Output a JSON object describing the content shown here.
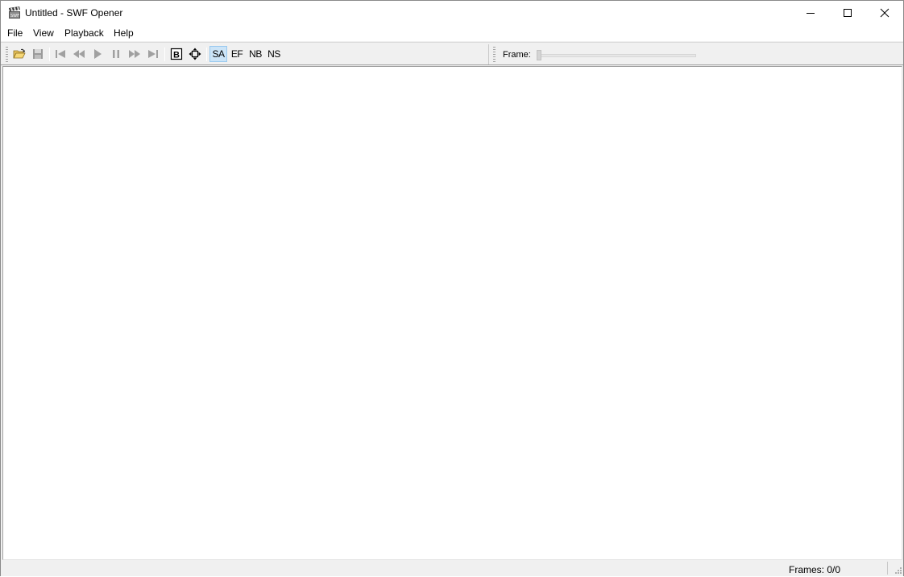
{
  "window": {
    "title": "Untitled - SWF Opener"
  },
  "menu": {
    "items": [
      "File",
      "View",
      "Playback",
      "Help"
    ]
  },
  "toolbar": {
    "buttons": [
      {
        "name": "open-button",
        "icon": "open-folder-icon"
      },
      {
        "name": "save-button",
        "icon": "save-disk-icon"
      },
      {
        "name": "first-frame-button",
        "icon": "skip-start-icon"
      },
      {
        "name": "rewind-button",
        "icon": "rewind-icon"
      },
      {
        "name": "play-button",
        "icon": "play-icon"
      },
      {
        "name": "pause-button",
        "icon": "pause-icon"
      },
      {
        "name": "forward-button",
        "icon": "fast-forward-icon"
      },
      {
        "name": "last-frame-button",
        "icon": "skip-end-icon"
      },
      {
        "name": "border-button",
        "icon": "boxed-b-icon"
      },
      {
        "name": "fit-button",
        "icon": "move-arrows-icon"
      }
    ],
    "scale_buttons": {
      "sa": "SA",
      "ef": "EF",
      "nb": "NB",
      "ns": "NS"
    },
    "active_scale": "SA"
  },
  "frame_slider": {
    "label": "Frame:",
    "value": 0
  },
  "status": {
    "frames": "Frames: 0/0"
  },
  "colors": {
    "active_button_bg": "#cce4f7",
    "active_button_border": "#99c9ef",
    "disabled_icon": "#a0a0a0"
  }
}
